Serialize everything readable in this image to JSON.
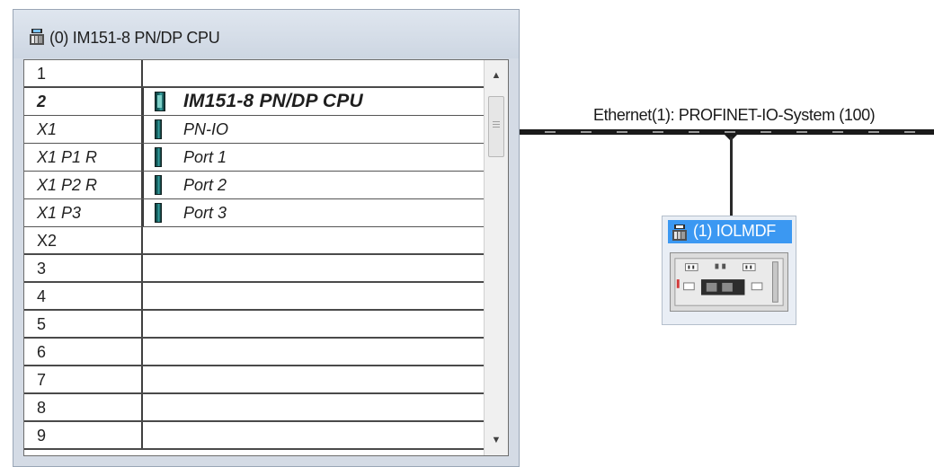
{
  "rack": {
    "title": "(0) IM151-8 PN/DP CPU",
    "rows": [
      {
        "slot": "1",
        "module": ""
      },
      {
        "slot": "2",
        "module": "IM151-8 PN/DP CPU"
      },
      {
        "slot": "X1",
        "module": "PN-IO"
      },
      {
        "slot": "X1 P1 R",
        "module": "Port 1"
      },
      {
        "slot": "X1 P2 R",
        "module": "Port 2"
      },
      {
        "slot": "X1 P3",
        "module": "Port 3"
      },
      {
        "slot": "X2",
        "module": ""
      },
      {
        "slot": "3",
        "module": ""
      },
      {
        "slot": "4",
        "module": ""
      },
      {
        "slot": "5",
        "module": ""
      },
      {
        "slot": "6",
        "module": ""
      },
      {
        "slot": "7",
        "module": ""
      },
      {
        "slot": "8",
        "module": ""
      },
      {
        "slot": "9",
        "module": ""
      }
    ]
  },
  "network": {
    "label": "Ethernet(1): PROFINET-IO-System (100)"
  },
  "device": {
    "title": "(1) IOLMDF"
  },
  "icons": {
    "station": "station-icon",
    "module": "module-icon",
    "scroll_up": "chevron-up-icon",
    "scroll_down": "chevron-down-icon"
  },
  "colors": {
    "selection": "#3b98f2",
    "window_bg": "#d4dbe5"
  }
}
